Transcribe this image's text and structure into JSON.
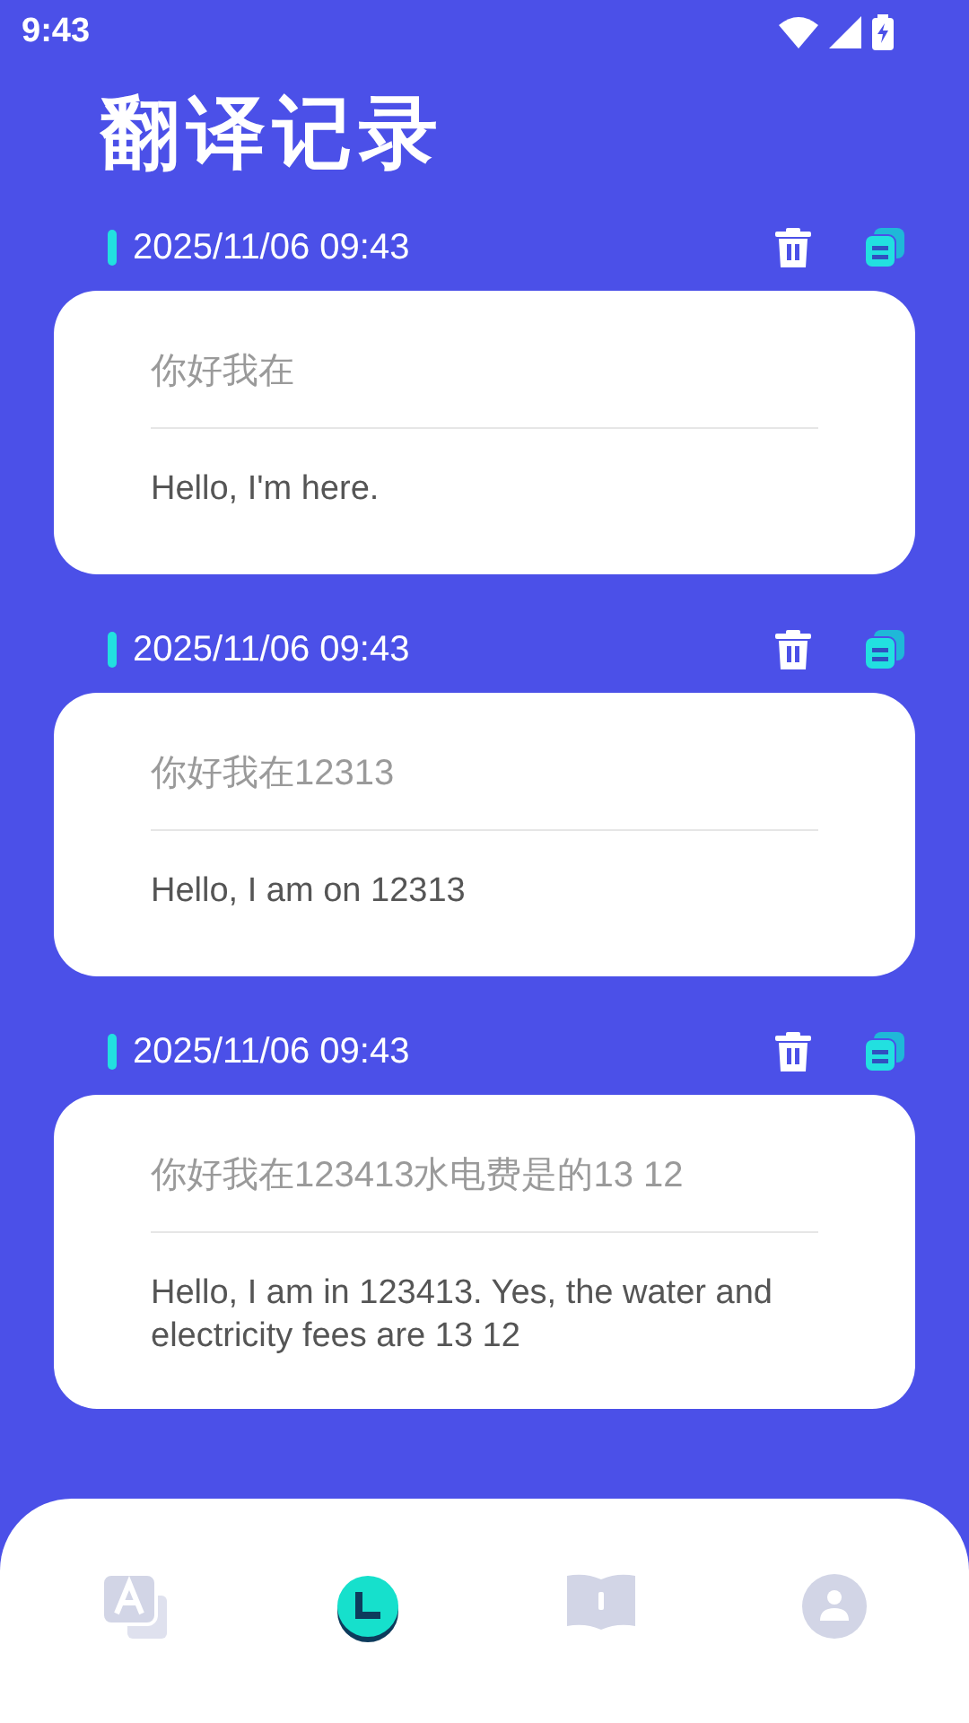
{
  "status_bar": {
    "time": "9:43"
  },
  "title": "翻译记录",
  "records": [
    {
      "time": "2025/11/06 09:43",
      "source": "你好我在",
      "translation": "Hello, I'm here."
    },
    {
      "time": "2025/11/06 09:43",
      "source": "你好我在12313",
      "translation": "Hello, I am on 12313"
    },
    {
      "time": "2025/11/06 09:43",
      "source": "你好我在123413水电费是的13 12",
      "translation": "Hello, I am in 123413. Yes, the water and electricity fees are 13 12"
    }
  ],
  "nav_tabs": [
    {
      "kind": "translate",
      "selected": false
    },
    {
      "kind": "history",
      "selected": true
    },
    {
      "kind": "book",
      "selected": false
    },
    {
      "kind": "profile",
      "selected": false
    }
  ]
}
